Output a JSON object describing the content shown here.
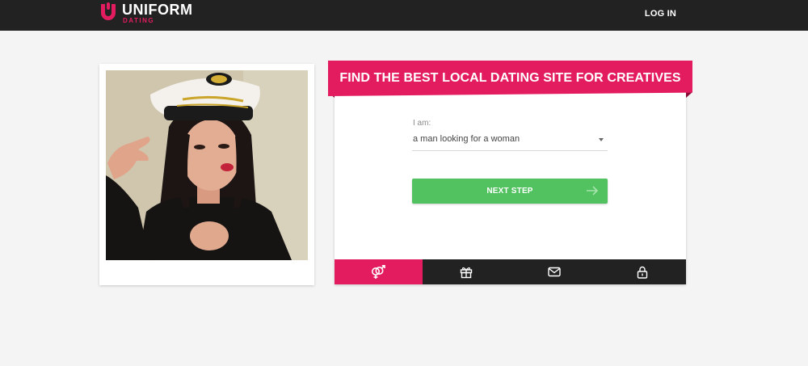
{
  "header": {
    "logo_name": "UNIFORM",
    "logo_sub": "DATING",
    "login_label": "LOG IN"
  },
  "hero": {
    "photo": "woman-in-captain-hat"
  },
  "form": {
    "title": "FIND THE BEST LOCAL DATING SITE FOR CREATIVES",
    "field_label": "I am:",
    "select_value": "a man looking for a woman",
    "next_label": "NEXT STEP"
  },
  "tabs": [
    {
      "icon": "gender-icon",
      "active": true
    },
    {
      "icon": "gift-icon",
      "active": false
    },
    {
      "icon": "mail-icon",
      "active": false
    },
    {
      "icon": "lock-icon",
      "active": false
    }
  ],
  "colors": {
    "brand_pink": "#e31c5f",
    "button_green": "#51c25f",
    "dark_bar": "#222222",
    "page_bg": "#f4f4f4"
  }
}
